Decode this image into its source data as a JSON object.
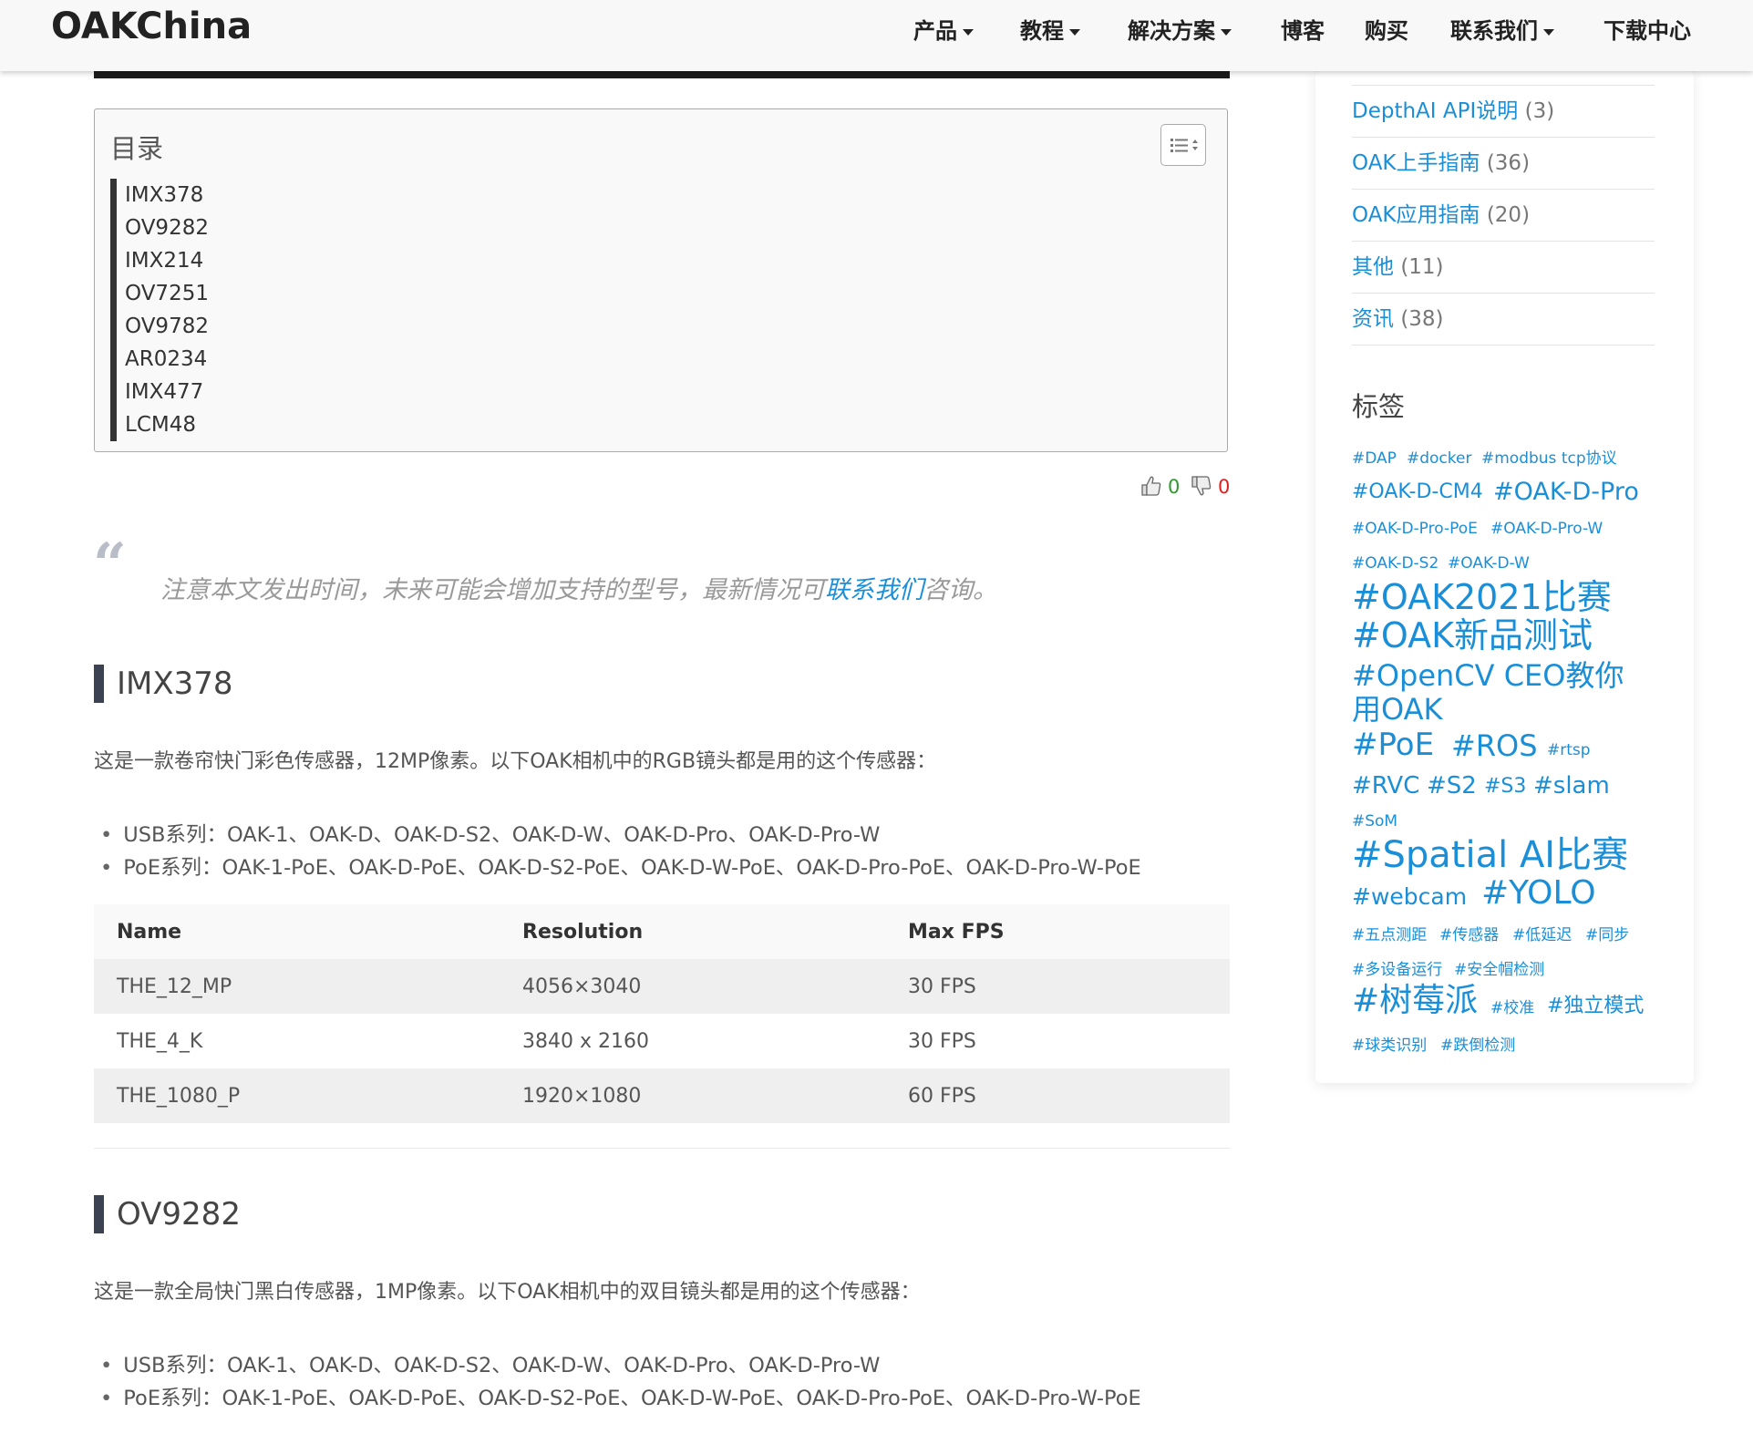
{
  "navbar": {
    "brand": "OAKChina",
    "items": [
      {
        "label": "产品",
        "dropdown": true
      },
      {
        "label": "教程",
        "dropdown": true
      },
      {
        "label": "解决方案",
        "dropdown": true
      },
      {
        "label": "博客",
        "dropdown": false
      },
      {
        "label": "购买",
        "dropdown": false
      },
      {
        "label": "联系我们",
        "dropdown": true
      },
      {
        "label": "下载中心",
        "dropdown": false
      }
    ]
  },
  "toc": {
    "title": "目录",
    "toggle_icon": "list-toggle-icon",
    "items": [
      "IMX378",
      "OV9282",
      "IMX214",
      "OV7251",
      "OV9782",
      "AR0234",
      "IMX477",
      "LCM48"
    ]
  },
  "votes": {
    "up": "0",
    "down": "0",
    "up_color": "#2e9a2e",
    "down_color": "#e02020"
  },
  "note": {
    "before": "注意本文发出时间，未来可能会增加支持的型号，最新情况可",
    "link": "联系我们",
    "after": "咨询。"
  },
  "sections": [
    {
      "heading": "IMX378",
      "description": "这是一款卷帘快门彩色传感器，12MP像素。以下OAK相机中的RGB镜头都是用的这个传感器：",
      "bullets": [
        "USB系列：OAK-1、OAK-D、OAK-D-S2、OAK-D-W、OAK-D-Pro、OAK-D-Pro-W",
        "PoE系列：OAK-1-PoE、OAK-D-PoE、OAK-D-S2-PoE、OAK-D-W-PoE、OAK-D-Pro-PoE、OAK-D-Pro-W-PoE"
      ],
      "table": {
        "headers": [
          "Name",
          "Resolution",
          "Max FPS"
        ],
        "rows": [
          [
            "THE_12_MP",
            "4056×3040",
            "30 FPS"
          ],
          [
            "THE_4_K",
            "3840 x 2160",
            "30 FPS"
          ],
          [
            "THE_1080_P",
            "1920×1080",
            "60 FPS"
          ]
        ]
      }
    },
    {
      "heading": "OV9282",
      "description": "这是一款全局快门黑白传感器，1MP像素。以下OAK相机中的双目镜头都是用的这个传感器：",
      "bullets": [
        "USB系列：OAK-1、OAK-D、OAK-D-S2、OAK-D-W、OAK-D-Pro、OAK-D-Pro-W",
        "PoE系列：OAK-1-PoE、OAK-D-PoE、OAK-D-S2-PoE、OAK-D-W-PoE、OAK-D-Pro-PoE、OAK-D-Pro-W-PoE"
      ]
    }
  ],
  "sidebar": {
    "categories": [
      {
        "name": "DepthAI API说明",
        "count": "(3)"
      },
      {
        "name": "OAK上手指南",
        "count": "(36)"
      },
      {
        "name": "OAK应用指南",
        "count": "(20)"
      },
      {
        "name": "其他",
        "count": "(11)"
      },
      {
        "name": "资讯",
        "count": "(38)"
      }
    ],
    "tags_title": "标签",
    "tags": [
      "#DAP",
      "#docker",
      "#modbus tcp协议",
      "#OAK-D-CM4",
      "#OAK-D-Pro",
      "#OAK-D-Pro-PoE",
      "#OAK-D-Pro-W",
      "#OAK-D-S2",
      "#OAK-D-W",
      "#OAK2021比赛",
      "#OAK新品测试",
      "#OpenCV CEO教你",
      "用OAK",
      "#PoE",
      "#ROS",
      "#rtsp",
      "#RVC",
      "#S2",
      "#S3",
      "#slam",
      "#SoM",
      "#Spatial AI比赛",
      "#webcam",
      "#YOLO",
      "#五点测距",
      "#传感器",
      "#低延迟",
      "#同步",
      "#多设备运行",
      "#安全帽检测",
      "#树莓派",
      "#校准",
      "#独立模式",
      "#球类识别",
      "#跌倒检测"
    ],
    "tag_color": "#1a8fd8"
  }
}
